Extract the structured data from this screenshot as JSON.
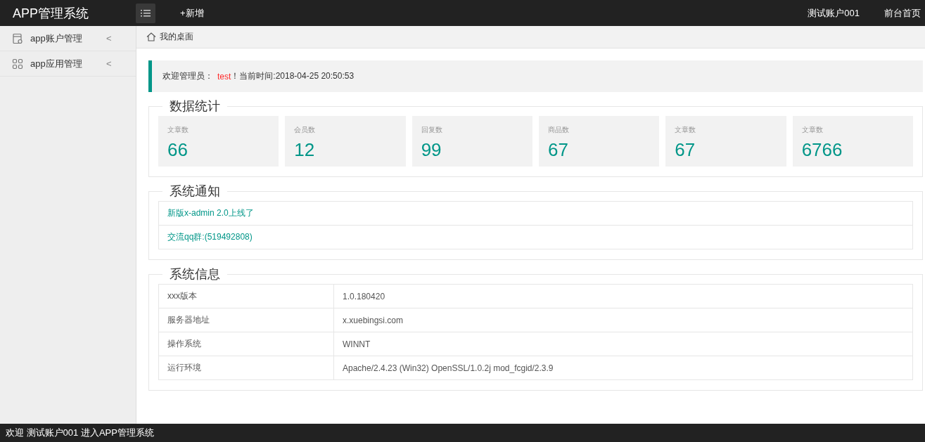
{
  "header": {
    "title": "APP管理系统",
    "add_link": "+新增",
    "account": "测试账户001",
    "home_link": "前台首页"
  },
  "sidebar": {
    "items": [
      {
        "label": "app账户管理",
        "kind": "account",
        "arrow": "<"
      },
      {
        "label": "app应用管理",
        "kind": "apps",
        "arrow": "<"
      }
    ]
  },
  "breadcrumb": "我的桌面",
  "welcome": {
    "prefix": "欢迎管理员：",
    "user": "test",
    "suffix": "！当前时间:2018-04-25 20:50:53"
  },
  "stats": {
    "title": "数据统计",
    "cards": [
      {
        "label": "文章数",
        "value": "66"
      },
      {
        "label": "会员数",
        "value": "12"
      },
      {
        "label": "回复数",
        "value": "99"
      },
      {
        "label": "商品数",
        "value": "67"
      },
      {
        "label": "文章数",
        "value": "67"
      },
      {
        "label": "文章数",
        "value": "6766"
      }
    ]
  },
  "notices": {
    "title": "系统通知",
    "items": [
      "新版x-admin 2.0上线了",
      "交流qq群:(519492808)"
    ]
  },
  "sysinfo": {
    "title": "系统信息",
    "rows": [
      {
        "name": "xxx版本",
        "value": "1.0.180420"
      },
      {
        "name": "服务器地址",
        "value": "x.xuebingsi.com"
      },
      {
        "name": "操作系统",
        "value": "WINNT"
      },
      {
        "name": "运行环境",
        "value": "Apache/2.4.23 (Win32) OpenSSL/1.0.2j mod_fcgid/2.3.9"
      }
    ]
  },
  "footer": "欢迎 测试账户001 进入APP管理系统"
}
